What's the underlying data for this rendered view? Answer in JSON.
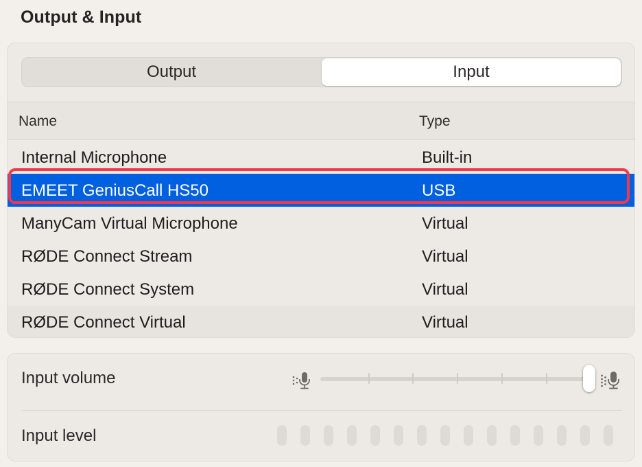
{
  "section": {
    "title": "Output & Input"
  },
  "tabs": [
    {
      "label": "Output",
      "selected": false
    },
    {
      "label": "Input",
      "selected": true
    }
  ],
  "table": {
    "columns": [
      "Name",
      "Type"
    ],
    "rows": [
      {
        "name": "Internal Microphone",
        "type": "Built-in"
      },
      {
        "name": "EMEET GeniusCall HS50",
        "type": "USB",
        "selected": true
      },
      {
        "name": "ManyCam Virtual Microphone",
        "type": "Virtual"
      },
      {
        "name": "RØDE Connect Stream",
        "type": "Virtual"
      },
      {
        "name": "RØDE Connect System",
        "type": "Virtual"
      },
      {
        "name": "RØDE Connect Virtual",
        "type": "Virtual"
      }
    ]
  },
  "volume": {
    "label": "Input volume",
    "value_fraction": 1.0,
    "low_icon": "microphone-low-icon",
    "high_icon": "microphone-high-icon"
  },
  "level": {
    "label": "Input level",
    "segments": 15,
    "active_segments": 0
  },
  "colors": {
    "selection": "#0060df",
    "highlight_border": "#f2384a",
    "background": "#f3efeb"
  }
}
